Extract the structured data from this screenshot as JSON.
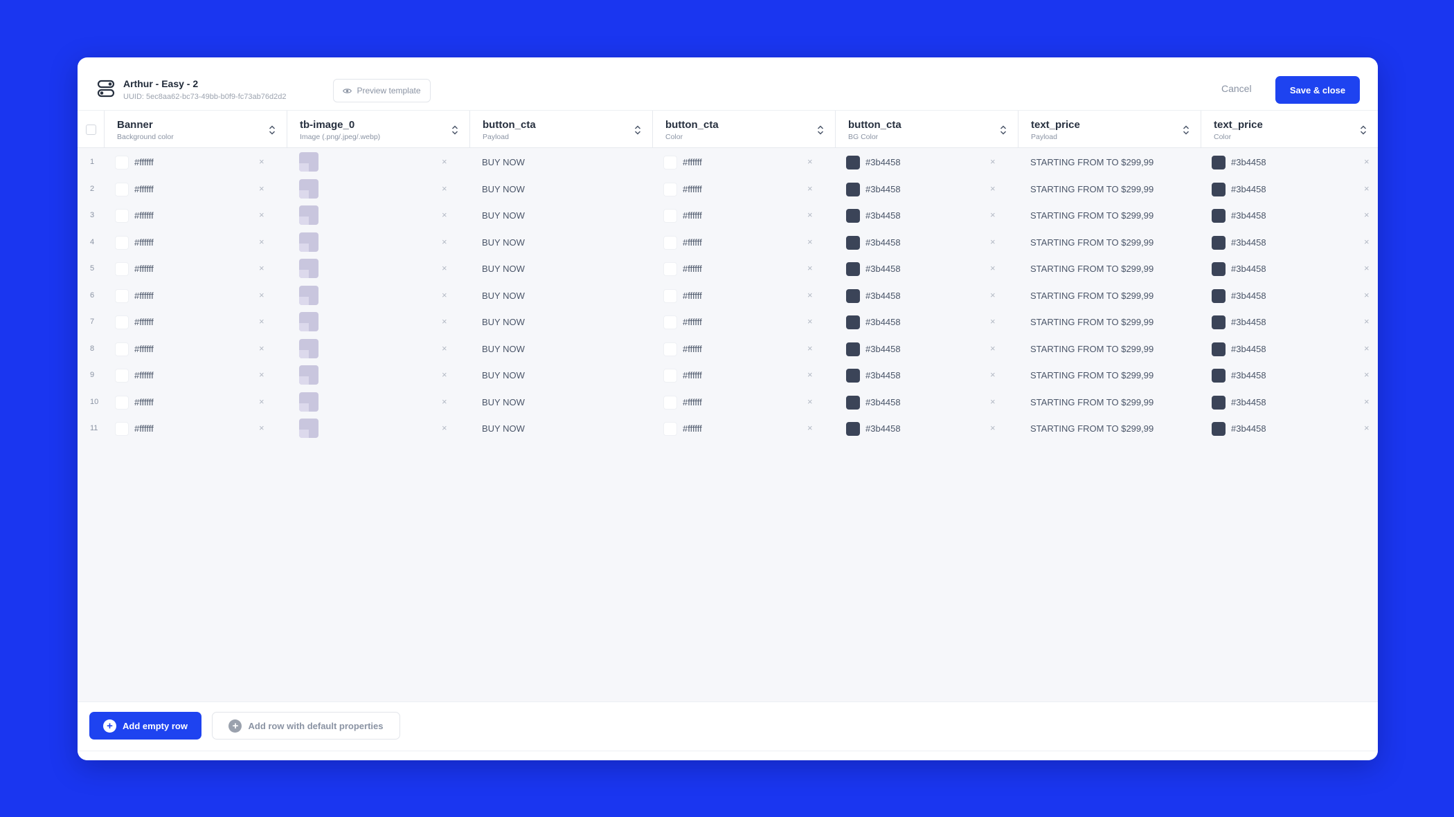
{
  "header": {
    "title": "Arthur - Easy - 2",
    "uuid": "UUID: 5ec8aa62-bc73-49bb-b0f9-fc73ab76d2d2",
    "preview_label": "Preview template",
    "cancel_label": "Cancel",
    "save_label": "Save & close"
  },
  "columns": [
    {
      "name": "Banner",
      "sub": "Background color"
    },
    {
      "name": "tb-image_0",
      "sub": "Image (.png/.jpeg/.webp)"
    },
    {
      "name": "button_cta",
      "sub": "Payload"
    },
    {
      "name": "button_cta",
      "sub": "Color"
    },
    {
      "name": "button_cta",
      "sub": "BG Color"
    },
    {
      "name": "text_price",
      "sub": "Payload"
    },
    {
      "name": "text_price",
      "sub": "Color"
    }
  ],
  "row_values": {
    "banner_color": "#ffffff",
    "cta_payload": "BUY NOW",
    "cta_color": "#ffffff",
    "cta_bg_color": "#3b4458",
    "price_payload": "STARTING FROM TO $299,99",
    "price_color": "#3b4458",
    "clear_glyph": "×"
  },
  "rows": [
    "1",
    "2",
    "3",
    "4",
    "5",
    "6",
    "7",
    "8",
    "9",
    "10",
    "11"
  ],
  "footer": {
    "add_empty_label": "Add empty row",
    "add_default_label": "Add row with default properties",
    "plus_glyph": "+"
  },
  "colors": {
    "background": "#1a36f0",
    "primary": "#1e43f0",
    "dark_swatch": "#3b4458",
    "white_swatch": "#ffffff"
  }
}
